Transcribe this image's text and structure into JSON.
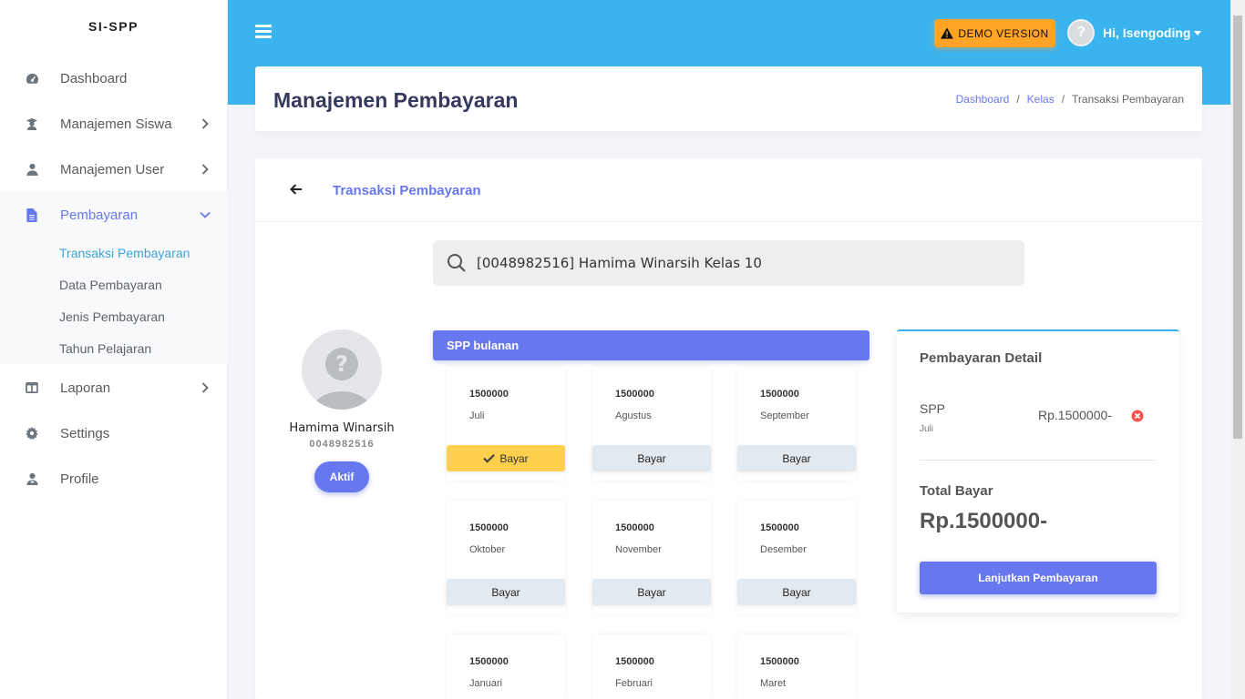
{
  "app": {
    "brand": "SI-SPP"
  },
  "sidebar": {
    "items": [
      {
        "label": "Dashboard",
        "icon": "dashboard-icon"
      },
      {
        "label": "Manajemen Siswa",
        "icon": "student-icon"
      },
      {
        "label": "Manajemen User",
        "icon": "user-icon"
      },
      {
        "label": "Pembayaran",
        "icon": "file-icon"
      },
      {
        "label": "Laporan",
        "icon": "columns-icon"
      },
      {
        "label": "Settings",
        "icon": "gear-icon"
      },
      {
        "label": "Profile",
        "icon": "profile-icon"
      }
    ],
    "submenu": [
      {
        "label": "Transaksi Pembayaran"
      },
      {
        "label": "Data Pembayaran"
      },
      {
        "label": "Jenis Pembayaran"
      },
      {
        "label": "Tahun Pelajaran"
      }
    ],
    "active_color": "#6777ef",
    "active_sub_color": "#3aa5d8"
  },
  "topbar": {
    "demo_label": "DEMO VERSION",
    "greeting": "Hi, Isengoding",
    "background": "#3ab4ef",
    "demo_color": "#ffa426"
  },
  "header": {
    "title": "Manajemen Pembayaran",
    "breadcrumb": [
      "Dashboard",
      "Kelas",
      "Transaksi Pembayaran"
    ]
  },
  "card": {
    "title": "Transaksi Pembayaran",
    "search_value": "[0048982516] Hamima Winarsih Kelas 10"
  },
  "student": {
    "name": "Hamima Winarsih",
    "nis": "0048982516",
    "status": "Aktif"
  },
  "spp": {
    "header": "SPP bulanan",
    "button_label": "Bayar",
    "months": [
      {
        "amount": "1500000",
        "name": "Juli",
        "selected": true
      },
      {
        "amount": "1500000",
        "name": "Agustus",
        "selected": false
      },
      {
        "amount": "1500000",
        "name": "September",
        "selected": false
      },
      {
        "amount": "1500000",
        "name": "Oktober",
        "selected": false
      },
      {
        "amount": "1500000",
        "name": "November",
        "selected": false
      },
      {
        "amount": "1500000",
        "name": "Desember",
        "selected": false
      },
      {
        "amount": "1500000",
        "name": "Januari",
        "selected": false
      },
      {
        "amount": "1500000",
        "name": "Februari",
        "selected": false
      },
      {
        "amount": "1500000",
        "name": "Maret",
        "selected": false
      }
    ]
  },
  "detail": {
    "title": "Pembayaran Detail",
    "item_name": "SPP",
    "item_month": "Juli",
    "item_amount": "Rp.1500000-",
    "total_label": "Total Bayar",
    "total_amount": "Rp.1500000-",
    "button_label": "Lanjutkan Pembayaran"
  }
}
